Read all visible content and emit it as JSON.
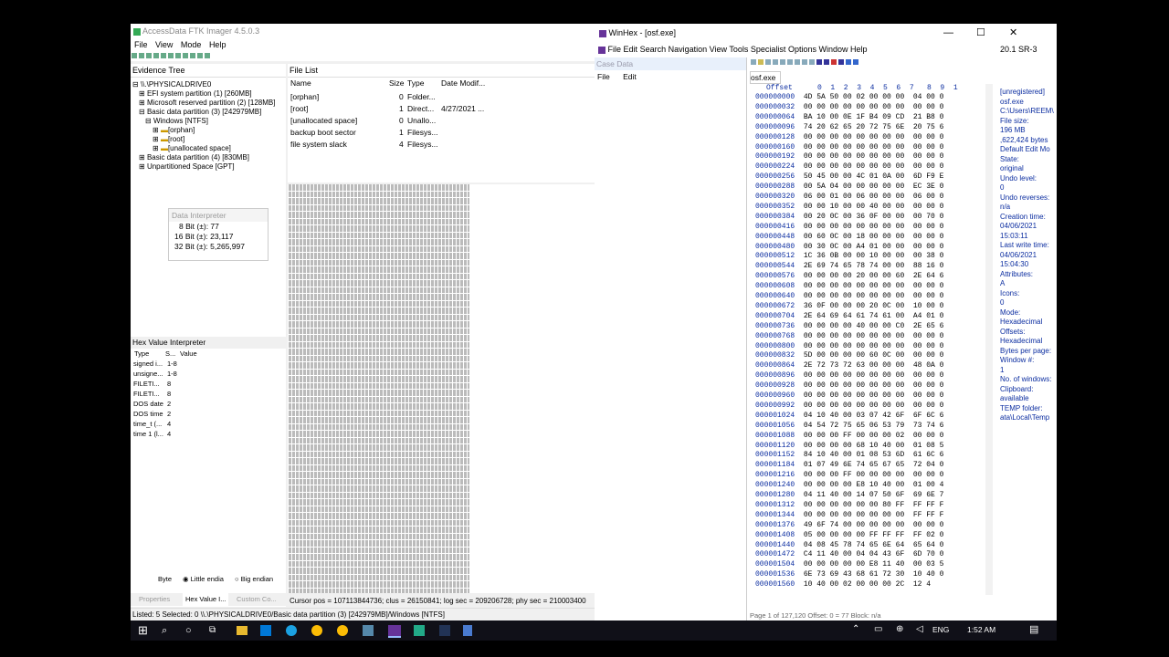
{
  "ftk": {
    "title": "AccessData FTK Imager 4.5.0.3",
    "menu": [
      "File",
      "View",
      "Mode",
      "Help"
    ],
    "evidence_tree": {
      "header": "Evidence Tree",
      "items": [
        "\\\\.\\PHYSICALDRIVE0",
        "EFI system partition (1) [260MB]",
        "Microsoft reserved partition (2) [128MB]",
        "Basic data partition (3) [242979MB]",
        "Windows [NTFS]",
        "[orphan]",
        "[root]",
        "[unallocated space]",
        "Basic data partition (4) [830MB]",
        "Unpartitioned Space [GPT]"
      ]
    },
    "file_list": {
      "header": "File List",
      "columns": [
        "Name",
        "Size",
        "Type",
        "Date Modif..."
      ],
      "rows": [
        {
          "name": "[orphan]",
          "size": "0",
          "type": "Folder...",
          "date": ""
        },
        {
          "name": "[root]",
          "size": "1",
          "type": "Direct...",
          "date": "4/27/2021 ..."
        },
        {
          "name": "[unallocated space]",
          "size": "0",
          "type": "Unallo...",
          "date": ""
        },
        {
          "name": "backup boot sector",
          "size": "1",
          "type": "Filesys...",
          "date": ""
        },
        {
          "name": "file system slack",
          "size": "4",
          "type": "Filesys...",
          "date": ""
        }
      ]
    },
    "data_interpreter": {
      "title": "Data Interpreter",
      "lines": [
        "8 Bit (±): 77",
        "16 Bit (±): 23,117",
        "32 Bit (±): 5,265,997"
      ]
    },
    "hex_value_interpreter": {
      "title": "Hex Value Interpreter",
      "columns": [
        "Type",
        "S...",
        "Value"
      ],
      "rows": [
        {
          "type": "signed i...",
          "size": "1-8"
        },
        {
          "type": "unsigne...",
          "size": "1-8"
        },
        {
          "type": "FILETI...",
          "size": "8"
        },
        {
          "type": "FILETI...",
          "size": "8"
        },
        {
          "type": "DOS date",
          "size": "2"
        },
        {
          "type": "DOS time",
          "size": "2"
        },
        {
          "type": "time_t (...",
          "size": "4"
        },
        {
          "type": "time 1 (l...",
          "size": "4"
        }
      ],
      "byte_label": "Byte",
      "little_endian": "Little endia",
      "big_endian": "Big endian",
      "tabs": [
        "Properties",
        "Hex Value I...",
        "Custom Co..."
      ]
    },
    "cursor_status": "Cursor pos = 107113844736; clus = 26150841; log sec = 209206728; phy sec = 210003400",
    "status_bar": "Listed: 5  Selected: 0  \\\\.\\PHYSICALDRIVE0/Basic data partition (3) [242979MB]/Windows [NTFS]"
  },
  "winhex": {
    "title": "WinHex - [osf.exe]",
    "menu": [
      "File",
      "Edit",
      "Search",
      "Navigation",
      "View",
      "Tools",
      "Specialist",
      "Options",
      "Window",
      "Help"
    ],
    "version": "20.1 SR-3",
    "case_data": "Case Data",
    "case_menu": [
      "File",
      "Edit"
    ],
    "tab": "osf.exe",
    "offset_header": "Offset",
    "columns": "0  1  2  3  4  5  6  7   8  9  1",
    "rows": [
      [
        "000000000",
        "4D 5A 50 00 02 00 00 00  04 00 0"
      ],
      [
        "000000032",
        "00 00 00 00 00 00 00 00  00 00 0"
      ],
      [
        "000000064",
        "BA 10 00 0E 1F B4 09 CD  21 B8 0"
      ],
      [
        "000000096",
        "74 20 62 65 20 72 75 6E  20 75 6"
      ],
      [
        "000000128",
        "00 00 00 00 00 00 00 00  00 00 0"
      ],
      [
        "000000160",
        "00 00 00 00 00 00 00 00  00 00 0"
      ],
      [
        "000000192",
        "00 00 00 00 00 00 00 00  00 00 0"
      ],
      [
        "000000224",
        "00 00 00 00 00 00 00 00  00 00 0"
      ],
      [
        "000000256",
        "50 45 00 00 4C 01 0A 00  6D F9 E"
      ],
      [
        "000000288",
        "00 5A 04 00 00 00 00 00  EC 3E 0"
      ],
      [
        "000000320",
        "06 00 01 00 06 00 00 00  06 00 0"
      ],
      [
        "000000352",
        "00 00 10 00 00 40 00 00  00 00 0"
      ],
      [
        "000000384",
        "00 20 0C 00 36 0F 00 00  00 70 0"
      ],
      [
        "000000416",
        "00 00 00 00 00 00 00 00  00 00 0"
      ],
      [
        "000000448",
        "00 60 0C 00 18 00 00 00  00 00 0"
      ],
      [
        "000000480",
        "00 30 0C 00 A4 01 00 00  00 00 0"
      ],
      [
        "000000512",
        "1C 36 0B 00 00 10 00 00  00 38 0"
      ],
      [
        "000000544",
        "2E 69 74 65 78 74 00 00  88 16 0"
      ],
      [
        "000000576",
        "00 00 00 00 20 00 00 60  2E 64 6"
      ],
      [
        "000000608",
        "00 00 00 00 00 00 00 00  00 00 0"
      ],
      [
        "000000640",
        "00 00 00 00 00 00 00 00  00 00 0"
      ],
      [
        "000000672",
        "36 0F 00 00 00 20 0C 00  10 00 0"
      ],
      [
        "000000704",
        "2E 64 69 64 61 74 61 00  A4 01 0"
      ],
      [
        "000000736",
        "00 00 00 00 40 00 00 C0  2E 65 6"
      ],
      [
        "000000768",
        "00 00 00 00 00 00 00 00  00 00 0"
      ],
      [
        "000000800",
        "00 00 00 00 00 00 00 00  00 00 0"
      ],
      [
        "000000832",
        "5D 00 00 00 00 60 0C 00  00 00 0"
      ],
      [
        "000000864",
        "2E 72 73 72 63 00 00 00  48 0A 0"
      ],
      [
        "000000896",
        "00 00 00 00 00 00 00 00  00 00 0"
      ],
      [
        "000000928",
        "00 00 00 00 00 00 00 00  00 00 0"
      ],
      [
        "000000960",
        "00 00 00 00 00 00 00 00  00 00 0"
      ],
      [
        "000000992",
        "00 00 00 00 00 00 00 00  00 00 0"
      ],
      [
        "000001024",
        "04 10 40 00 03 07 42 6F  6F 6C 6"
      ],
      [
        "000001056",
        "04 54 72 75 65 06 53 79  73 74 6"
      ],
      [
        "000001088",
        "00 00 00 FF 00 00 00 02  00 00 0"
      ],
      [
        "000001120",
        "00 00 00 00 68 10 40 00  01 08 5"
      ],
      [
        "000001152",
        "84 10 40 00 01 08 53 6D  61 6C 6"
      ],
      [
        "000001184",
        "01 07 49 6E 74 65 67 65  72 04 0"
      ],
      [
        "000001216",
        "00 00 00 FF 00 00 00 00  00 00 0"
      ],
      [
        "000001240",
        "00 00 00 00 E8 10 40 00  01 00 4"
      ],
      [
        "000001280",
        "04 11 40 00 14 07 50 6F  69 6E 7"
      ],
      [
        "000001312",
        "00 00 00 00 00 00 80 FF  FF FF F"
      ],
      [
        "000001344",
        "00 00 00 00 00 00 00 00  FF FF F"
      ],
      [
        "000001376",
        "49 6F 74 00 00 00 00 00  00 00 0"
      ],
      [
        "000001408",
        "05 00 00 00 00 FF FF FF  FF 02 0"
      ],
      [
        "000001440",
        "04 08 45 78 74 65 6E 64  65 64 0"
      ],
      [
        "000001472",
        "C4 11 40 00 04 04 43 6F  6D 70 0"
      ],
      [
        "000001504",
        "00 00 00 00 00 E8 11 40  00 03 5"
      ],
      [
        "000001536",
        "6E 73 69 43 68 61 72 30  10 40 0"
      ],
      [
        "000001560",
        "10 40 00 02 00 00 00 2C  12 4 "
      ]
    ],
    "right_panel": [
      "[unregistered]",
      "osf.exe",
      "C:\\Users\\REEM\\",
      "File size:",
      "196 MB",
      ",622,424 bytes",
      "Default Edit Mo",
      "State:",
      "original",
      "Undo level:",
      "0",
      "Undo reverses:",
      "n/a",
      "Creation time:",
      "04/06/2021",
      "15:03:11",
      "Last write time:",
      "04/06/2021",
      "15:04:30",
      "Attributes:",
      "A",
      "Icons:",
      "0",
      "Mode:",
      "Hexadecimal",
      "Offsets:",
      "Hexadecimal",
      "Bytes per page:",
      "Window #:",
      "1",
      "No. of windows:",
      "Clipboard:",
      "available",
      "TEMP folder:",
      "ata\\Local\\Temp"
    ],
    "status": "Page 1 of 127,120    Offset:    0    = 77 Block:    n/a"
  },
  "taskbar": {
    "lang": "ENG",
    "time": "1:52 AM"
  }
}
